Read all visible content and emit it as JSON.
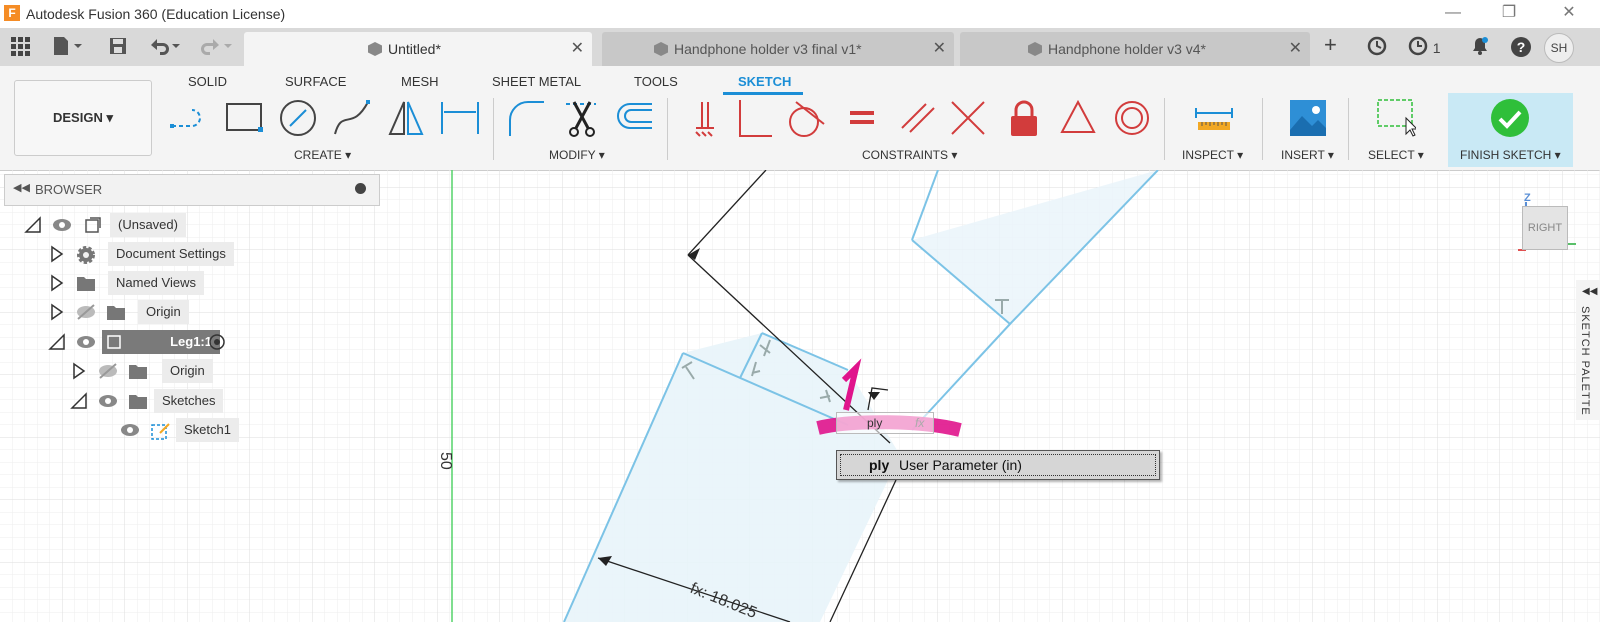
{
  "window": {
    "title": "Autodesk Fusion 360 (Education License)",
    "logo": "F",
    "minimize": "—",
    "restore": "❐",
    "close": "✕"
  },
  "tabs": [
    {
      "label": "Untitled*",
      "close": "✕"
    },
    {
      "label": "Handphone holder v3 final v1*",
      "close": "✕"
    },
    {
      "label": "Handphone holder v3 v4*",
      "close": "✕"
    }
  ],
  "topbar": {
    "job_count": "1",
    "user_initials": "SH",
    "new_tab": "+"
  },
  "ribbon": {
    "workspace": "DESIGN ▾",
    "tabs": [
      "SOLID",
      "SURFACE",
      "MESH",
      "SHEET METAL",
      "TOOLS",
      "SKETCH"
    ],
    "active_tab": "SKETCH",
    "groups": {
      "create": "CREATE ▾",
      "modify": "MODIFY ▾",
      "constraints": "CONSTRAINTS ▾",
      "inspect": "INSPECT ▾",
      "insert": "INSERT ▾",
      "select": "SELECT ▾",
      "finish": "FINISH SKETCH ▾"
    }
  },
  "browser": {
    "title": "BROWSER",
    "items": [
      {
        "label": "(Unsaved)"
      },
      {
        "label": "Document Settings"
      },
      {
        "label": "Named Views"
      },
      {
        "label": "Origin"
      },
      {
        "label": "Leg1:1"
      },
      {
        "label": "Origin"
      },
      {
        "label": "Sketches"
      },
      {
        "label": "Sketch1"
      }
    ]
  },
  "canvas": {
    "axis_label": "50",
    "dimension_label": "fx: 18.025",
    "input_value": "ply",
    "input_fx": "fx",
    "viewcube": "RIGHT",
    "sketch_palette": "SKETCH PALETTE"
  },
  "autocomplete": {
    "name": "ply",
    "description": "User Parameter (in)"
  },
  "colors": {
    "accent": "#1b8ed6",
    "sketch_line": "#7cc3e6",
    "finish_green": "#2fbf3a",
    "annotation_magenta": "#e0148c"
  }
}
